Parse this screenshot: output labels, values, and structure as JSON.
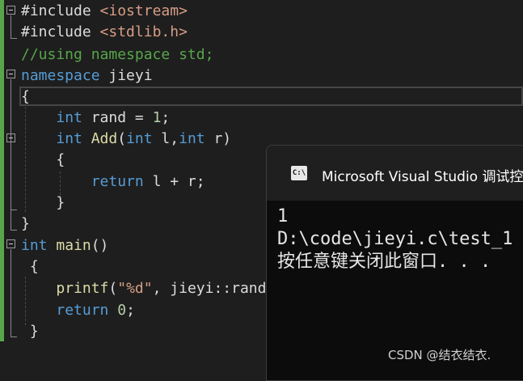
{
  "editor": {
    "lines": [
      [
        {
          "t": "#include ",
          "c": "id"
        },
        {
          "t": "<iostream>",
          "c": "st"
        }
      ],
      [
        {
          "t": "#include ",
          "c": "id"
        },
        {
          "t": "<stdlib.h>",
          "c": "st"
        }
      ],
      [
        {
          "t": "//using namespace std;",
          "c": "cm"
        }
      ],
      [
        {
          "t": "namespace",
          "c": "kw"
        },
        {
          "t": " jieyi",
          "c": "id"
        }
      ],
      [
        {
          "t": "{",
          "c": "id"
        }
      ],
      [
        {
          "t": "    ",
          "c": "id"
        },
        {
          "t": "int",
          "c": "kw"
        },
        {
          "t": " rand = ",
          "c": "id"
        },
        {
          "t": "1",
          "c": "num"
        },
        {
          "t": ";",
          "c": "id"
        }
      ],
      [
        {
          "t": "    ",
          "c": "id"
        },
        {
          "t": "int",
          "c": "kw"
        },
        {
          "t": " ",
          "c": "id"
        },
        {
          "t": "Add",
          "c": "fn"
        },
        {
          "t": "(",
          "c": "id"
        },
        {
          "t": "int",
          "c": "kw"
        },
        {
          "t": " l,",
          "c": "id"
        },
        {
          "t": "int",
          "c": "kw"
        },
        {
          "t": " r)",
          "c": "id"
        }
      ],
      [
        {
          "t": "    {",
          "c": "id"
        }
      ],
      [
        {
          "t": "        ",
          "c": "id"
        },
        {
          "t": "return",
          "c": "kw"
        },
        {
          "t": " l + r;",
          "c": "id"
        }
      ],
      [
        {
          "t": "    }",
          "c": "id"
        }
      ],
      [
        {
          "t": "}",
          "c": "id"
        }
      ],
      [
        {
          "t": "int",
          "c": "kw"
        },
        {
          "t": " ",
          "c": "id"
        },
        {
          "t": "main",
          "c": "fn"
        },
        {
          "t": "()",
          "c": "id"
        }
      ],
      [
        {
          "t": " {",
          "c": "id"
        }
      ],
      [
        {
          "t": "    ",
          "c": "id"
        },
        {
          "t": "printf",
          "c": "fn"
        },
        {
          "t": "(",
          "c": "id"
        },
        {
          "t": "\"%d\"",
          "c": "st"
        },
        {
          "t": ", jieyi::rand);",
          "c": "id"
        }
      ],
      [
        {
          "t": "    ",
          "c": "id"
        },
        {
          "t": "return",
          "c": "kw"
        },
        {
          "t": " ",
          "c": "id"
        },
        {
          "t": "0",
          "c": "num"
        },
        {
          "t": ";",
          "c": "id"
        }
      ],
      [
        {
          "t": " }",
          "c": "id"
        }
      ]
    ]
  },
  "console": {
    "title": "Microsoft Visual Studio 调试控制台",
    "icon": "console-window-icon",
    "icon_glyph": "C:\\",
    "output": [
      "1",
      "D:\\code\\jieyi.c\\test_1",
      "按任意键关闭此窗口. . ."
    ]
  },
  "watermark": "CSDN @结衣结衣."
}
